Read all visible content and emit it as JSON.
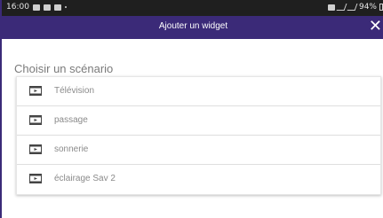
{
  "statusbar": {
    "time": "16:00",
    "battery": "94%"
  },
  "header": {
    "title": "Ajouter un widget",
    "close_label": "✕",
    "bg_color": "#3b2a78"
  },
  "section": {
    "title": "Choisir un scénario"
  },
  "scenarios": [
    {
      "label": "Télévision",
      "icon": "film-icon"
    },
    {
      "label": "passage",
      "icon": "film-icon"
    },
    {
      "label": "sonnerie",
      "icon": "film-icon"
    },
    {
      "label": "éclairage Sav 2",
      "icon": "film-icon"
    }
  ]
}
